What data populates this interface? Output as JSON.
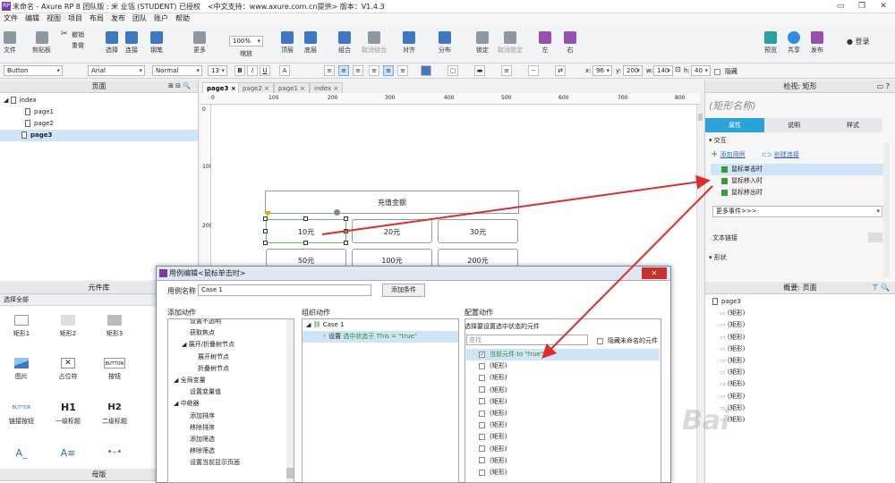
{
  "window": {
    "title": "未命名 - Axure RP 8 团队版 : 米 业瓴 (STUDENT) 已授权　<中文支持：www.axure.com.cn提供> 版本：V1.4.3",
    "app_icon": "axure-logo",
    "buttons": [
      "▭",
      "❐",
      "✕"
    ]
  },
  "menu": [
    "文件",
    "编辑",
    "视图",
    "项目",
    "布局",
    "发布",
    "团队",
    "账户",
    "帮助"
  ],
  "toolbar": {
    "file": "文件",
    "clipboard": "剪贴板",
    "cut_icon": "✂",
    "undo": "撤销",
    "redo": "重做",
    "select": "选择",
    "connect": "连接",
    "pen": "钢笔",
    "more": "更多",
    "zoom_value": "100%",
    "zoom_label": "缩放",
    "top": "顶层",
    "bottom": "底层",
    "group": "组合",
    "ungroup": "取消组合",
    "align": "对齐",
    "distribute": "分布",
    "lock": "锁定",
    "unlock": "取消锁定",
    "left": "左",
    "right": "右",
    "preview": "预览",
    "share": "共享",
    "publish": "发布",
    "login": "登录"
  },
  "format": {
    "widget_type": "Button",
    "font": "Arial",
    "style": "Normal",
    "size": "13",
    "x_label": "x:",
    "x": "96",
    "y_label": "y:",
    "y": "200",
    "w_label": "w:",
    "w": "140",
    "h_label": "h:",
    "h": "40",
    "hidden": "隐藏"
  },
  "pages_panel": {
    "title": "页面",
    "root": "index",
    "pages": [
      "page1",
      "page2",
      "page3"
    ],
    "selected": "page3"
  },
  "library_panel": {
    "title": "元件库",
    "selector": "选择全部",
    "items": [
      {
        "label": "矩形1",
        "icon": "rect-icon"
      },
      {
        "label": "矩形2",
        "icon": "rect-icon"
      },
      {
        "label": "矩形3",
        "icon": "rect-icon"
      },
      {
        "label": "图片",
        "icon": "image-icon"
      },
      {
        "label": "占位符",
        "icon": "placeholder-icon"
      },
      {
        "label": "按钮",
        "icon": "button-icon"
      },
      {
        "label": "链接按钮",
        "icon": "link-button-icon"
      },
      {
        "label": "一级标题",
        "icon": "h1-icon"
      },
      {
        "label": "二级标题",
        "icon": "h2-icon"
      }
    ],
    "h1": "H1",
    "h2": "H2",
    "button_text": "BUTTON",
    "masters_title": "母版"
  },
  "tabs": [
    "page3",
    "page2",
    "page1",
    "index"
  ],
  "ruler": {
    "h": [
      "0",
      "100",
      "200",
      "300",
      "400",
      "500",
      "600",
      "700",
      "800"
    ],
    "v": [
      "0",
      "100",
      "200"
    ]
  },
  "canvas": {
    "header": "充值金额",
    "row1": [
      "10元",
      "20元",
      "30元"
    ],
    "row2": [
      "50元",
      "100元",
      "200元"
    ]
  },
  "inspector": {
    "title": "检视: 矩形",
    "name_placeholder": "(矩形名称)",
    "tabs": [
      "属性",
      "说明",
      "样式"
    ],
    "section": "交互",
    "add_case": "添加用例",
    "create_link": "创建连接",
    "events": [
      "鼠标单击时",
      "鼠标移入时",
      "鼠标移出时"
    ],
    "more_events": "更多事件>>>",
    "text_link": "文本链接",
    "shape": "形状"
  },
  "outline": {
    "title": "概要: 页面",
    "page": "page3",
    "items": [
      "(矩形)",
      "(矩形)",
      "(矩形)",
      "(矩形)",
      "(矩形)",
      "(矩形)",
      "(矩形)",
      "(矩形)",
      "(矩形)",
      "(矩形)"
    ]
  },
  "dialog": {
    "title": "用例编辑<鼠标单击时>",
    "case_name_label": "用例名称",
    "case_name": "Case 1",
    "add_condition": "添加条件",
    "col1": "添加动作",
    "col2": "组织动作",
    "col3": "配置动作",
    "actions": [
      {
        "t": "设置不透明",
        "l": 2
      },
      {
        "t": "获取焦点",
        "l": 2
      },
      {
        "t": "展开/折叠树节点",
        "l": 1
      },
      {
        "t": "展开树节点",
        "l": 3
      },
      {
        "t": "折叠树节点",
        "l": 3
      },
      {
        "t": "全局变量",
        "l": 0
      },
      {
        "t": "设置变量值",
        "l": 2
      },
      {
        "t": "中继器",
        "l": 0
      },
      {
        "t": "添加排序",
        "l": 2
      },
      {
        "t": "移除排序",
        "l": 2
      },
      {
        "t": "添加筛选",
        "l": 2
      },
      {
        "t": "移除筛选",
        "l": 2
      },
      {
        "t": "设置当前显示页面",
        "l": 2
      }
    ],
    "case": "Case 1",
    "action_prefix": "设置",
    "action_text": "选中状态于 This = \"true\"",
    "config_title": "选择要设置选中状态的元件",
    "search_placeholder": "查找",
    "hide_unnamed": "隐藏未命名的元件",
    "targets": [
      {
        "t": "当前元件 to \"true\"",
        "c": true
      },
      {
        "t": "(矩形)",
        "c": false
      },
      {
        "t": "(矩形)",
        "c": false
      },
      {
        "t": "(矩形)",
        "c": false
      },
      {
        "t": "(矩形)",
        "c": false
      },
      {
        "t": "(矩形)",
        "c": false
      },
      {
        "t": "(矩形)",
        "c": false
      },
      {
        "t": "(矩形)",
        "c": false
      },
      {
        "t": "(矩形)",
        "c": false
      },
      {
        "t": "(矩形)",
        "c": false
      },
      {
        "t": "(矩形)",
        "c": false
      }
    ],
    "close": "✕"
  },
  "watermark": "Bai",
  "colors": {
    "accent": "#29a3d8",
    "arrow": "#e02b2b",
    "selected": "#cfe4f7",
    "action_green": "#2e8b2e"
  }
}
